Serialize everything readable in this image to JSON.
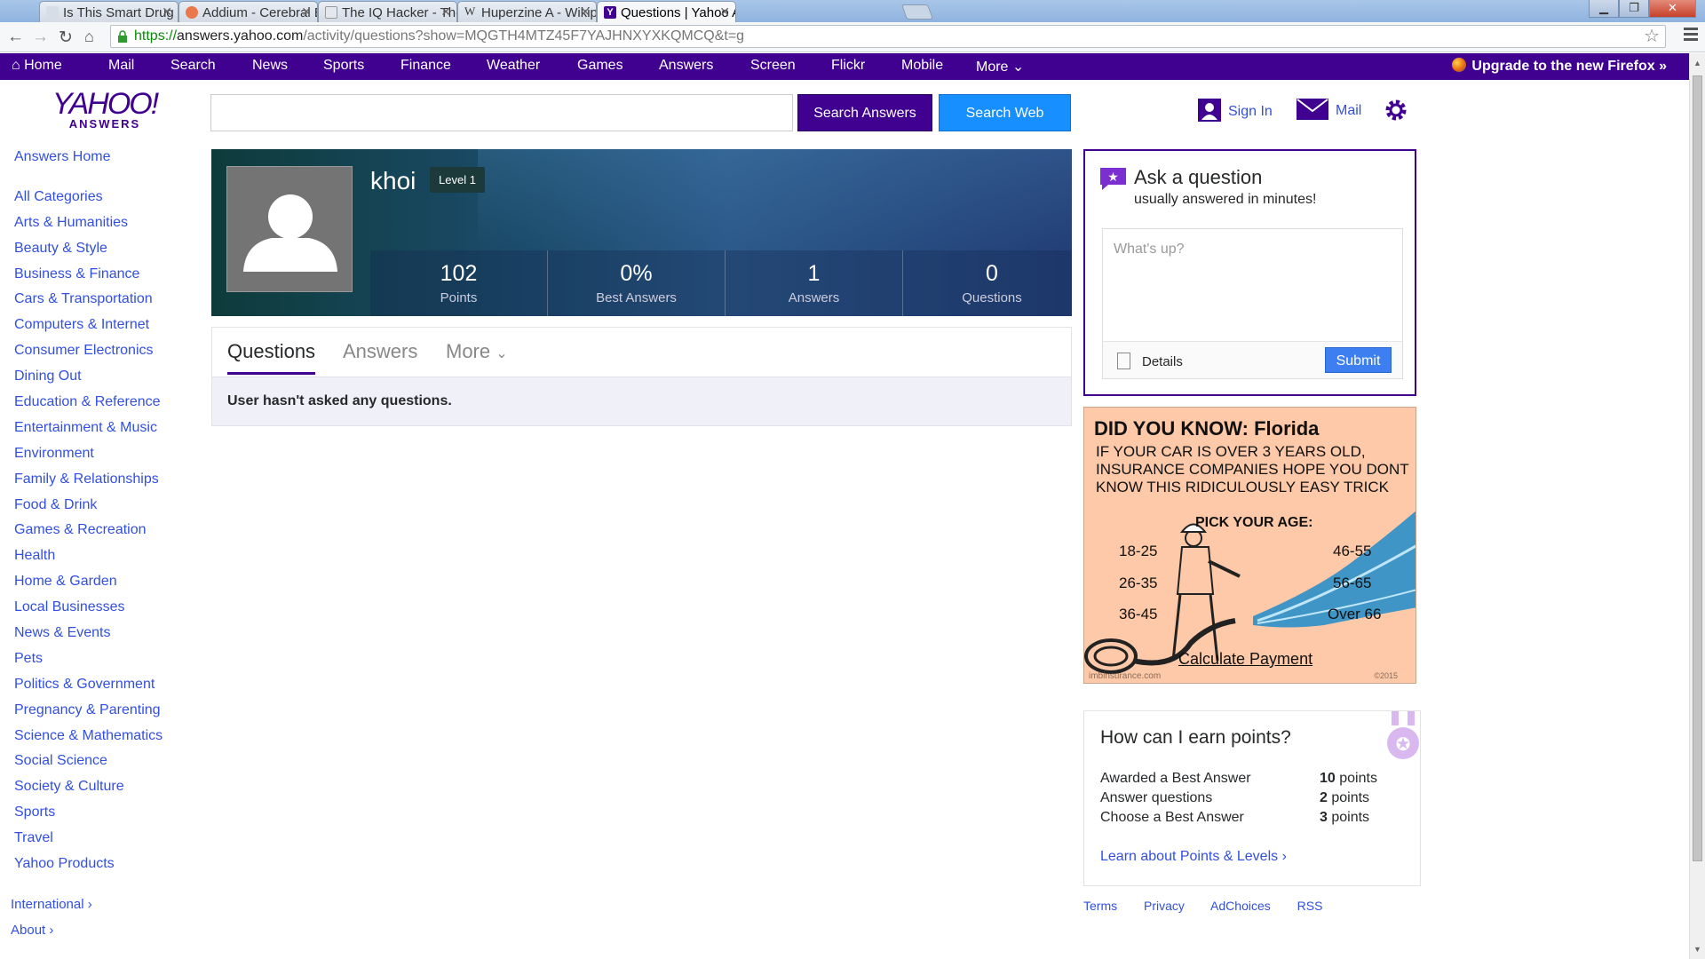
{
  "browser": {
    "tabs": [
      {
        "label": "Is This Smart Drug Th",
        "active": false
      },
      {
        "label": "Addium - Cerebral E",
        "active": false
      },
      {
        "label": "The IQ Hacker - The",
        "active": false
      },
      {
        "label": "Huperzine A - Wikip",
        "active": false
      },
      {
        "label": "Questions | Yahoo Ar",
        "active": true
      }
    ],
    "url_scheme": "https://",
    "url_host": "answers.yahoo.com",
    "url_path": "/activity/questions?show=MQGTH4MTZ45F7YAJHNXYXKQMCQ&t=g"
  },
  "yahoo_nav": {
    "items": [
      "Home",
      "Mail",
      "Search",
      "News",
      "Sports",
      "Finance",
      "Weather",
      "Games",
      "Answers",
      "Screen",
      "Flickr",
      "Mobile",
      "More"
    ],
    "upgrade": "Upgrade to the new Firefox »"
  },
  "logo": {
    "top": "YAHOO!",
    "bottom": "ANSWERS"
  },
  "sidebar": {
    "home": "Answers Home",
    "categories": [
      "All Categories",
      "Arts & Humanities",
      "Beauty & Style",
      "Business & Finance",
      "Cars & Transportation",
      "Computers & Internet",
      "Consumer Electronics",
      "Dining Out",
      "Education & Reference",
      "Entertainment & Music",
      "Environment",
      "Family & Relationships",
      "Food & Drink",
      "Games & Recreation",
      "Health",
      "Home & Garden",
      "Local Businesses",
      "News & Events",
      "Pets",
      "Politics & Government",
      "Pregnancy & Parenting",
      "Science & Mathematics",
      "Social Science",
      "Society & Culture",
      "Sports",
      "Travel",
      "Yahoo Products"
    ],
    "international": "International",
    "about": "About"
  },
  "search": {
    "value": "",
    "answers_button": "Search Answers",
    "web_button": "Search Web"
  },
  "header_actions": {
    "signin": "Sign In",
    "mail": "Mail"
  },
  "profile": {
    "username": "khoi",
    "level": "Level 1",
    "stats": [
      {
        "value": "102",
        "label": "Points"
      },
      {
        "value": "0%",
        "label": "Best Answers"
      },
      {
        "value": "1",
        "label": "Answers"
      },
      {
        "value": "0",
        "label": "Questions"
      }
    ]
  },
  "profile_tabs": {
    "questions": "Questions",
    "answers": "Answers",
    "more": "More"
  },
  "empty_message": "User hasn't asked any questions.",
  "ask": {
    "title": "Ask a question",
    "subtitle": "usually answered in minutes!",
    "placeholder": "What's up?",
    "details": "Details",
    "submit": "Submit"
  },
  "ad": {
    "headline": "DID YOU KNOW: Florida",
    "body": "IF YOUR CAR IS OVER 3 YEARS OLD, INSURANCE COMPANIES HOPE YOU DONT KNOW THIS RIDICULOUSLY EASY TRICK",
    "pick": "PICK YOUR AGE:",
    "ages": [
      "18-25",
      "26-35",
      "36-45",
      "46-55",
      "56-65",
      "Over 66"
    ],
    "cta": "Calculate Payment",
    "source": "imbinsurance.com",
    "year": "©2015"
  },
  "points": {
    "title": "How can I earn points?",
    "rows": [
      {
        "label": "Awarded a Best Answer",
        "value": "10",
        "unit": "points"
      },
      {
        "label": "Answer questions",
        "value": "2",
        "unit": "points"
      },
      {
        "label": "Choose a Best Answer",
        "value": "3",
        "unit": "points"
      }
    ],
    "learn": "Learn about Points & Levels"
  },
  "footer": [
    "Terms",
    "Privacy",
    "AdChoices",
    "RSS"
  ],
  "colors": {
    "yahoo_purple": "#400090",
    "link_blue": "#324fe1",
    "search_web_blue": "#188fff",
    "submit_blue": "#3d7ff1",
    "ad_bg": "#fdc9a8"
  }
}
